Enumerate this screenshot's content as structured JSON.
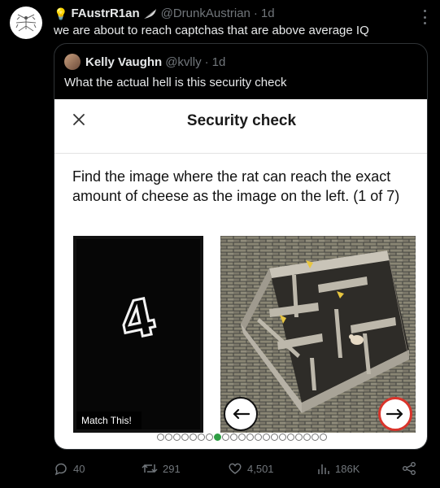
{
  "tweet": {
    "author_name": "FAustrR1an",
    "handle": "@DrunkAustrian",
    "separator": "·",
    "time": "1d",
    "text": "we are about to reach captchas that are above average IQ"
  },
  "quoted": {
    "author_name": "Kelly Vaughn",
    "handle": "@kvlly",
    "separator": "·",
    "time": "1d",
    "text": "What the actual hell is this security check"
  },
  "captcha": {
    "title": "Security check",
    "prompt": "Find the image where the rat can reach the exact amount of cheese as the image on the left. (1 of 7)",
    "left_digit": "4",
    "match_label": "Match This!",
    "dots_total": 21,
    "dots_active_index": 7
  },
  "actions": {
    "replies": "40",
    "reposts": "291",
    "likes": "4,501",
    "views": "186K"
  },
  "colors": {
    "background": "#000000",
    "muted": "#71767b",
    "active_dot": "#2f9e44",
    "next_ring": "#d9342b"
  }
}
